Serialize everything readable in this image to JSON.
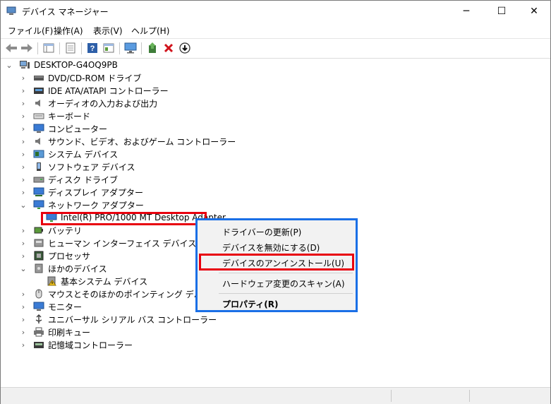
{
  "window": {
    "title": "デバイス マネージャー",
    "minimize": "─",
    "maximize": "☐",
    "close": "✕"
  },
  "menu": {
    "file": "ファイル(F)",
    "action": "操作(A)",
    "view": "表示(V)",
    "help": "ヘルプ(H)"
  },
  "toolbar": {
    "icons": [
      "back-arrow-icon",
      "forward-arrow-icon",
      "show-hide-tree-icon",
      "properties-icon",
      "help-icon",
      "view-icon",
      "scan-monitor-icon",
      "update-driver-icon",
      "uninstall-icon",
      "disable-icon"
    ]
  },
  "tree": {
    "root": "DESKTOP-G4OQ9PB",
    "items": [
      {
        "label": "DVD/CD-ROM ドライブ",
        "icon": "dvd-drive-icon",
        "state": "collapsed"
      },
      {
        "label": "IDE ATA/ATAPI コントローラー",
        "icon": "ide-controller-icon",
        "state": "collapsed"
      },
      {
        "label": "オーディオの入力および出力",
        "icon": "audio-icon",
        "state": "collapsed"
      },
      {
        "label": "キーボード",
        "icon": "keyboard-icon",
        "state": "collapsed"
      },
      {
        "label": "コンピューター",
        "icon": "computer-icon",
        "state": "collapsed"
      },
      {
        "label": "サウンド、ビデオ、およびゲーム コントローラー",
        "icon": "sound-icon",
        "state": "collapsed"
      },
      {
        "label": "システム デバイス",
        "icon": "system-device-icon",
        "state": "collapsed"
      },
      {
        "label": "ソフトウェア デバイス",
        "icon": "software-device-icon",
        "state": "collapsed"
      },
      {
        "label": "ディスク ドライブ",
        "icon": "disk-drive-icon",
        "state": "collapsed"
      },
      {
        "label": "ディスプレイ アダプター",
        "icon": "display-adapter-icon",
        "state": "collapsed"
      },
      {
        "label": "ネットワーク アダプター",
        "icon": "network-adapter-icon",
        "state": "expanded"
      },
      {
        "label": "Intel(R) PRO/1000 MT Desktop Adapter",
        "icon": "network-card-icon",
        "state": "child"
      },
      {
        "label": "バッテリ",
        "icon": "battery-icon",
        "state": "collapsed"
      },
      {
        "label": "ヒューマン インターフェイス デバイス",
        "icon": "hid-icon",
        "state": "collapsed"
      },
      {
        "label": "プロセッサ",
        "icon": "processor-icon",
        "state": "collapsed"
      },
      {
        "label": "ほかのデバイス",
        "icon": "other-device-icon",
        "state": "expanded"
      },
      {
        "label": "基本システム デバイス",
        "icon": "warning-device-icon",
        "state": "child"
      },
      {
        "label": "マウスとそのほかのポインティング デバイス",
        "icon": "mouse-icon",
        "state": "collapsed"
      },
      {
        "label": "モニター",
        "icon": "monitor-icon",
        "state": "collapsed"
      },
      {
        "label": "ユニバーサル シリアル バス コントローラー",
        "icon": "usb-icon",
        "state": "collapsed"
      },
      {
        "label": "印刷キュー",
        "icon": "printer-icon",
        "state": "collapsed"
      },
      {
        "label": "記憶域コントローラー",
        "icon": "storage-controller-icon",
        "state": "collapsed"
      }
    ]
  },
  "context_menu": {
    "items": [
      {
        "label": "ドライバーの更新(P)",
        "bold": false
      },
      {
        "label": "デバイスを無効にする(D)",
        "bold": false
      },
      {
        "label": "デバイスのアンインストール(U)",
        "bold": false
      },
      {
        "label": "ハードウェア変更のスキャン(A)",
        "bold": false
      },
      {
        "label": "プロパティ(R)",
        "bold": true
      }
    ]
  },
  "colors": {
    "highlight_red": "#e8000e",
    "menu_border_blue": "#1a6fe6"
  }
}
